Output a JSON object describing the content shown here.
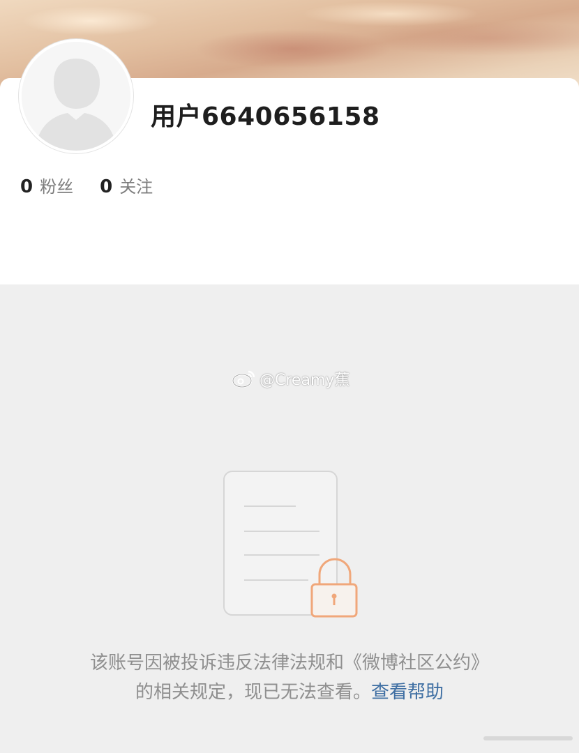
{
  "profile": {
    "username": "用户6640656158",
    "stats": [
      {
        "count": "0",
        "label": "粉丝"
      },
      {
        "count": "0",
        "label": "关注"
      }
    ]
  },
  "watermark": {
    "icon": "weibo-logo-icon",
    "text": "@Creamy蕉"
  },
  "notice": {
    "line1": "该账号因被投诉违反法律法规和《微博社区公约》",
    "line2_prefix": "的相关规定，现已无法查看。",
    "help_link": "查看帮助"
  },
  "colors": {
    "accent_link": "#3f6fa3",
    "lock_orange": "#f0a77a",
    "background": "#efefef"
  }
}
